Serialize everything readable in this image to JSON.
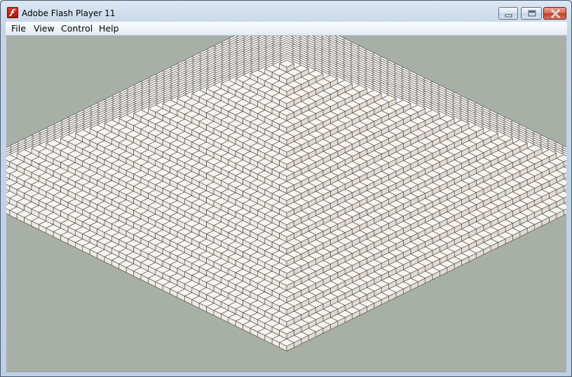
{
  "window": {
    "title": "Adobe Flash Player 11",
    "controls": {
      "minimize": "minimize",
      "maximize": "maximize",
      "close": "close"
    }
  },
  "menu": [
    "File",
    "View",
    "Control",
    "Help"
  ],
  "colors": {
    "stage_bg": "#a8afa7",
    "block_face": "#efeae4",
    "block_top": "#f7f4f0",
    "block_side": "#e2dcd5",
    "block_edge": "#555555"
  },
  "icons": {
    "app": "flash-player-icon"
  },
  "scene": {
    "pyramid_levels": 24
  }
}
